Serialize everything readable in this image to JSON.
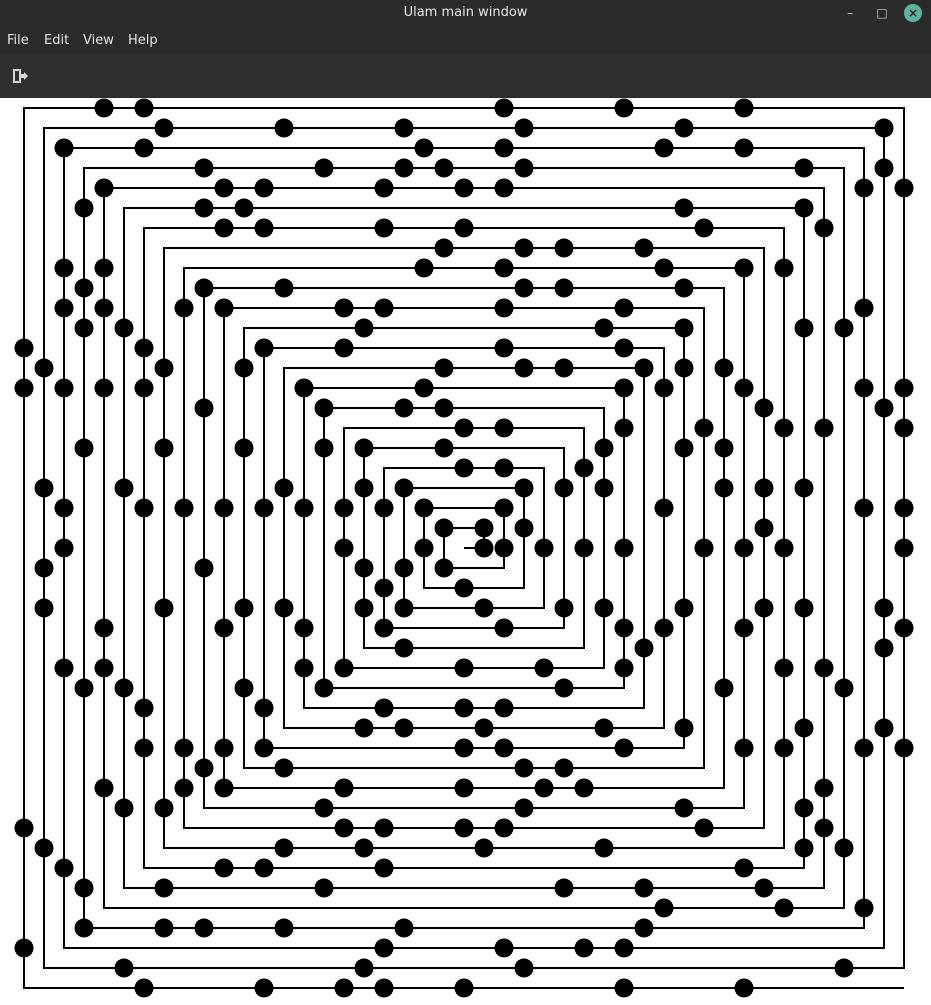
{
  "window": {
    "title": "Ulam main window",
    "minimize_glyph": "–",
    "maximize_glyph": "□",
    "close_glyph": "×"
  },
  "menu": {
    "items": [
      {
        "label": "File"
      },
      {
        "label": "Edit"
      },
      {
        "label": "View"
      },
      {
        "label": "Help"
      }
    ]
  },
  "toolbar": {
    "buttons": [
      {
        "icon": "exit-icon"
      }
    ]
  },
  "colors": {
    "titlebar": "#2b2b2b",
    "toolbar": "#2f2f2f",
    "close_button": "#5db3a0",
    "spiral": "#000000",
    "background": "#ffffff"
  },
  "spiral": {
    "type": "Ulam spiral",
    "grid_size": 45,
    "start_number": 1,
    "marked": "primes"
  }
}
